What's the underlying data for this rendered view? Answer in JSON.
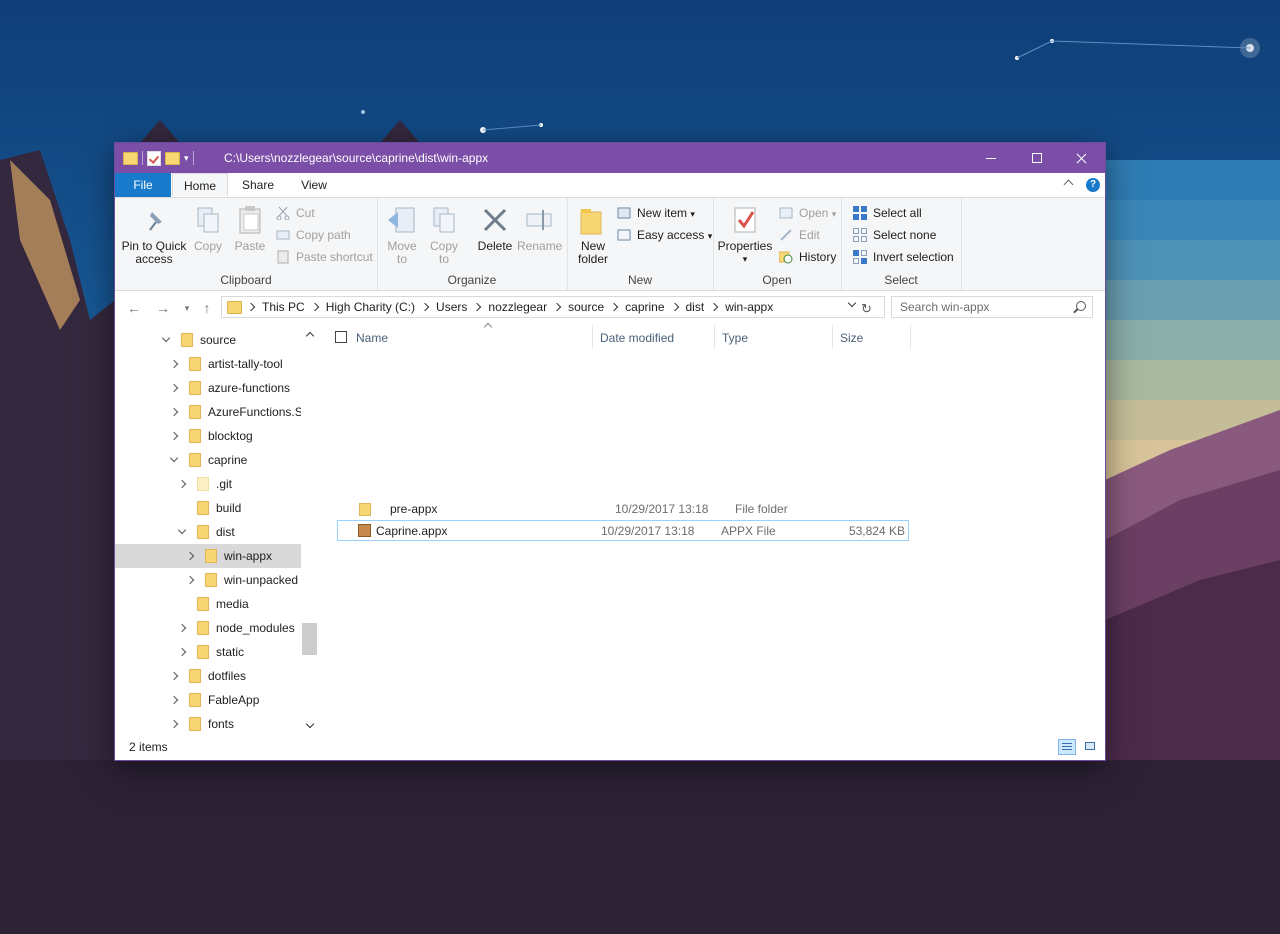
{
  "window": {
    "title_path": "C:\\Users\\nozzlegear\\source\\caprine\\dist\\win-appx",
    "accent_color": "#7b4fa8"
  },
  "ribbon_tabs": [
    {
      "label": "File"
    },
    {
      "label": "Home"
    },
    {
      "label": "Share"
    },
    {
      "label": "View"
    }
  ],
  "ribbon": {
    "clipboard": {
      "label": "Clipboard",
      "pin": "Pin to Quick access",
      "pin_line1": "Pin to Quick",
      "pin_line2": "access",
      "copy": "Copy",
      "paste": "Paste",
      "cut": "Cut",
      "copy_path": "Copy path",
      "paste_shortcut": "Paste shortcut"
    },
    "organize": {
      "label": "Organize",
      "move_to_line1": "Move",
      "move_to_line2": "to",
      "copy_to_line1": "Copy",
      "copy_to_line2": "to",
      "delete": "Delete",
      "rename": "Rename"
    },
    "new": {
      "label": "New",
      "new_folder_line1": "New",
      "new_folder_line2": "folder",
      "new_item": "New item",
      "easy_access": "Easy access"
    },
    "open": {
      "label": "Open",
      "properties": "Properties",
      "open": "Open",
      "edit": "Edit",
      "history": "History"
    },
    "select": {
      "label": "Select",
      "select_all": "Select all",
      "select_none": "Select none",
      "invert_selection": "Invert selection"
    }
  },
  "address_bar": {
    "crumbs": [
      "This PC",
      "High Charity (C:)",
      "Users",
      "nozzlegear",
      "source",
      "caprine",
      "dist",
      "win-appx"
    ],
    "search_placeholder": "Search win-appx"
  },
  "nav_tree": [
    {
      "label": "source"
    },
    {
      "label": "artist-tally-tool"
    },
    {
      "label": "azure-functions"
    },
    {
      "label": "AzureFunctions.Sa"
    },
    {
      "label": "blocktog"
    },
    {
      "label": "caprine"
    },
    {
      "label": ".git"
    },
    {
      "label": "build"
    },
    {
      "label": "dist"
    },
    {
      "label": "win-appx"
    },
    {
      "label": "win-unpacked"
    },
    {
      "label": "media"
    },
    {
      "label": "node_modules"
    },
    {
      "label": "static"
    },
    {
      "label": "dotfiles"
    },
    {
      "label": "FableApp"
    },
    {
      "label": "fonts"
    }
  ],
  "columns": {
    "name": "Name",
    "date": "Date modified",
    "type": "Type",
    "size": "Size"
  },
  "files": [
    {
      "name": "pre-appx",
      "date": "10/29/2017 13:18",
      "type": "File folder",
      "size": ""
    },
    {
      "name": "Caprine.appx",
      "date": "10/29/2017 13:18",
      "type": "APPX File",
      "size": "53,824 KB"
    }
  ],
  "status": {
    "item_count": "2 items"
  }
}
